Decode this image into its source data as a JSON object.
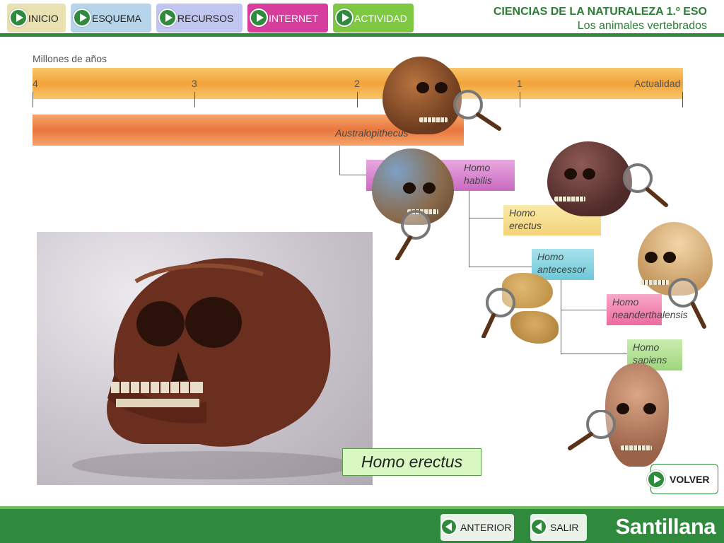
{
  "nav": {
    "inicio": "INICIO",
    "esquema": "ESQUEMA",
    "recursos": "RECURSOS",
    "internet": "INTERNET",
    "actividad": "ACTIVIDAD"
  },
  "header": {
    "title": "CIENCIAS DE LA NATURALEZA 1.º ESO",
    "subtitle": "Los animales vertebrados"
  },
  "timeline": {
    "axis_title": "Millones de años",
    "ticks": [
      "4",
      "3",
      "2",
      "1",
      "Actualidad"
    ]
  },
  "species": {
    "australopithecus": "Australopithecus",
    "habilis": [
      "Homo",
      "habilis"
    ],
    "erectus": [
      "Homo",
      "erectus"
    ],
    "antecessor": [
      "Homo",
      "antecessor"
    ],
    "neanderthalensis": [
      "Homo",
      "neanderthalensis"
    ],
    "sapiens": [
      "Homo",
      "sapiens"
    ]
  },
  "main": {
    "caption": "Homo erectus"
  },
  "buttons": {
    "volver": "VOLVER",
    "anterior": "ANTERIOR",
    "salir": "SALIR"
  },
  "brand": "Santillana",
  "colors": {
    "accent_green": "#2f8a3e",
    "timebar": "#f2a33a",
    "australopithecus": "#e8773d",
    "habilis": "#c96ac0",
    "erectus": "#f3d27a",
    "antecessor": "#6ec8d8",
    "neanderthalensis": "#ec6aa0",
    "sapiens": "#9ed67c"
  },
  "icons": [
    "play-icon",
    "magnifier-icon",
    "back-arrow-icon"
  ]
}
